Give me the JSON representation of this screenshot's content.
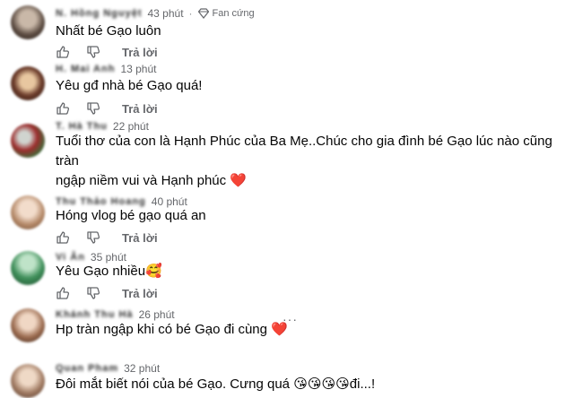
{
  "comments": [
    {
      "name": "N. Hồng Nguyệt",
      "time": "43 phút",
      "badge": "Fan cứng",
      "text": "Nhất bé Gạo luôn",
      "emoji": "",
      "reply": "Trả lời"
    },
    {
      "name": "H. Mai Anh",
      "time": "13 phút",
      "badge": "",
      "text": "Yêu gđ nhà bé Gạo quá!",
      "emoji": "",
      "reply": "Trả lời"
    },
    {
      "name": "T. Hà Thu",
      "time": "22 phút",
      "badge": "",
      "text": "Tuổi thơ của con là Hạnh Phúc của Ba Mẹ..Chúc cho gia đình bé Gạo lúc nào cũng tràn",
      "text2": "ngập niềm vui và Hạnh phúc",
      "emoji": "❤️",
      "reply": ""
    },
    {
      "name": "Thu Thảo Hoang",
      "time": "40 phút",
      "badge": "",
      "text": "Hóng vlog bé gạo quá an",
      "emoji": "",
      "reply": "Trả lời"
    },
    {
      "name": "Vi Ân",
      "time": "35 phút",
      "badge": "",
      "text": "Yêu Gạo nhiều",
      "emoji": "🥰",
      "reply": "Trả lời"
    },
    {
      "name": "Khánh Thu Hà",
      "time": "26 phút",
      "badge": "",
      "text": "Hp tràn ngập khi có bé Gạo đi cùng",
      "emoji": "❤️",
      "reply": ""
    },
    {
      "name": "Quan Pham",
      "time": "32 phút",
      "badge": "",
      "text": "Đôi mắt biết nói của bé Gạo. Cưng quá",
      "emoji": "😘😘😘😘",
      "text_after": "đi...!",
      "reply": ""
    }
  ],
  "icons": {
    "like": "thumb-up-icon",
    "dislike": "thumb-down-icon",
    "fan": "diamond-icon",
    "more": "more-dots-icon"
  },
  "colors": {
    "meta": "#65676b",
    "text": "#050505",
    "heart": "#e0245e"
  }
}
